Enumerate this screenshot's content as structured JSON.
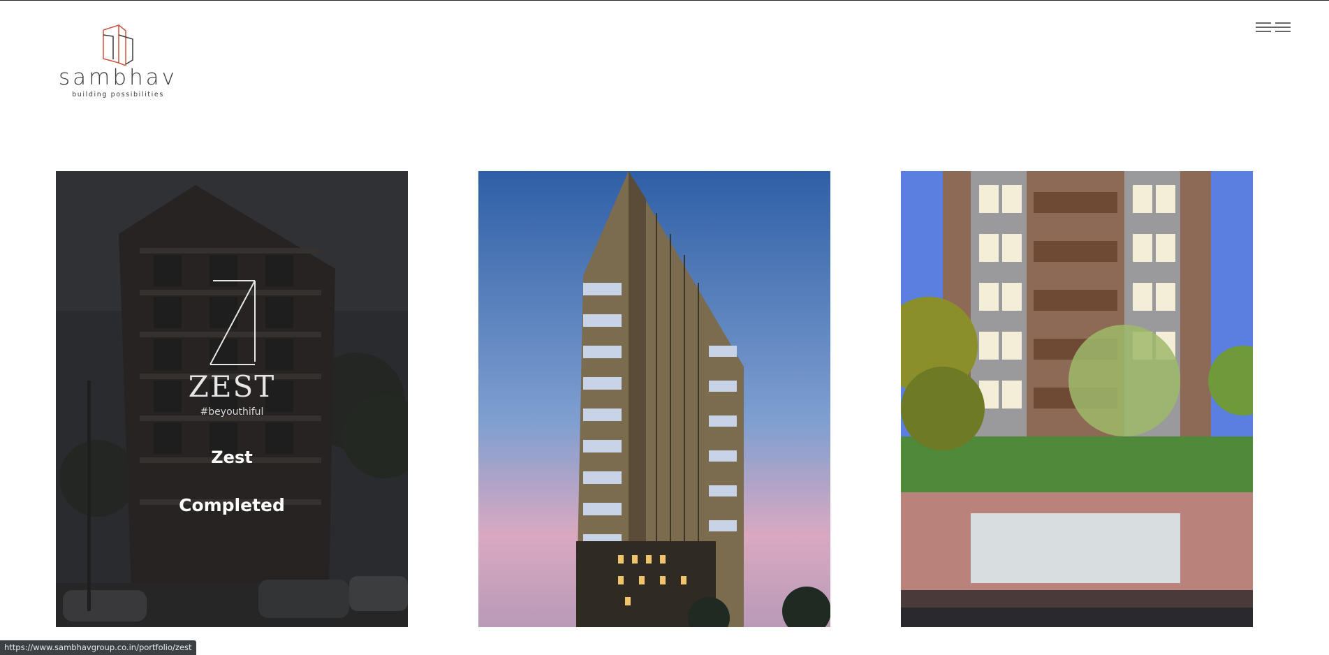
{
  "brand": {
    "name": "sambhav",
    "tagline": "building possibilities",
    "accent_color": "#c8553d",
    "text_color": "#3a3a3a"
  },
  "nav": {
    "menu_icon": "hamburger-menu-icon"
  },
  "portfolio": {
    "cards": [
      {
        "project_logo": {
          "letter": "Z",
          "wordmark": "ZEST",
          "hashtag": "#beyouthiful"
        },
        "title": "Zest",
        "status": "Completed",
        "hovered": true,
        "image": "tower-evening-street-photo"
      },
      {
        "image": "tall-tower-dusk-render"
      },
      {
        "image": "green-facade-street-render"
      }
    ]
  },
  "statusbar": {
    "url": "https://www.sambhavgroup.co.in/portfolio/zest"
  }
}
